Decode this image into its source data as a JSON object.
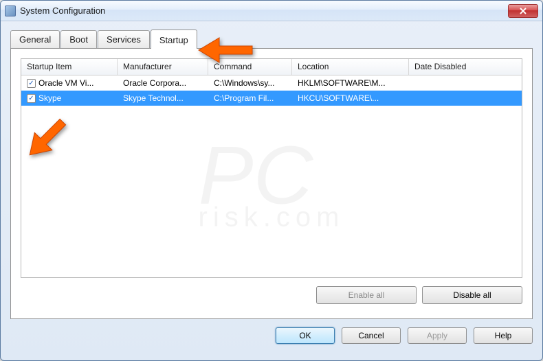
{
  "window": {
    "title": "System Configuration"
  },
  "tabs": {
    "general": "General",
    "boot": "Boot",
    "services": "Services",
    "startup": "Startup"
  },
  "columns": {
    "startup": "Startup Item",
    "manufacturer": "Manufacturer",
    "command": "Command",
    "location": "Location",
    "date": "Date Disabled"
  },
  "rows": [
    {
      "checked": true,
      "selected": false,
      "startup": "Oracle VM Vi...",
      "manufacturer": "Oracle Corpora...",
      "command": "C:\\Windows\\sy...",
      "location": "HKLM\\SOFTWARE\\M...",
      "date": ""
    },
    {
      "checked": true,
      "selected": true,
      "startup": "Skype",
      "manufacturer": "Skype Technol...",
      "command": "C:\\Program Fil...",
      "location": "HKCU\\SOFTWARE\\...",
      "date": ""
    }
  ],
  "buttons": {
    "enable_all": "Enable all",
    "disable_all": "Disable all",
    "ok": "OK",
    "cancel": "Cancel",
    "apply": "Apply",
    "help": "Help"
  },
  "watermark": {
    "main": "PC",
    "sub": "risk.com"
  }
}
